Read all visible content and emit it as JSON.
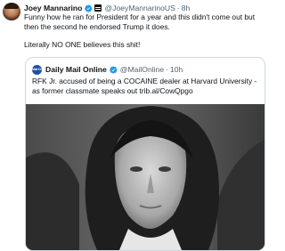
{
  "tweet": {
    "author_name": "Joey Mannarino",
    "author_handle": "@JoeyMannarinoUS",
    "time": "8h",
    "dot": "·",
    "paragraphs": [
      "Funny how he ran for President for a year and this didn't come out but then the second he endorsed Trump it does.",
      "Literally NO ONE believes this shit!"
    ]
  },
  "quote": {
    "logo_text": "Mail Online",
    "author_name": "Daily Mail Online",
    "author_handle": "@MailOnline",
    "time": "10h",
    "dot": "·",
    "text": "RFK Jr. accused of being a COCAINE dealer at Harvard University - as former classmate speaks out trib.al/CowQpgo"
  },
  "colors": {
    "verified_blue": "#1d9bf0",
    "muted_text": "#536471",
    "border": "#cfd9de"
  },
  "icons": [
    "verified-badge-icon",
    "flag-icon"
  ]
}
